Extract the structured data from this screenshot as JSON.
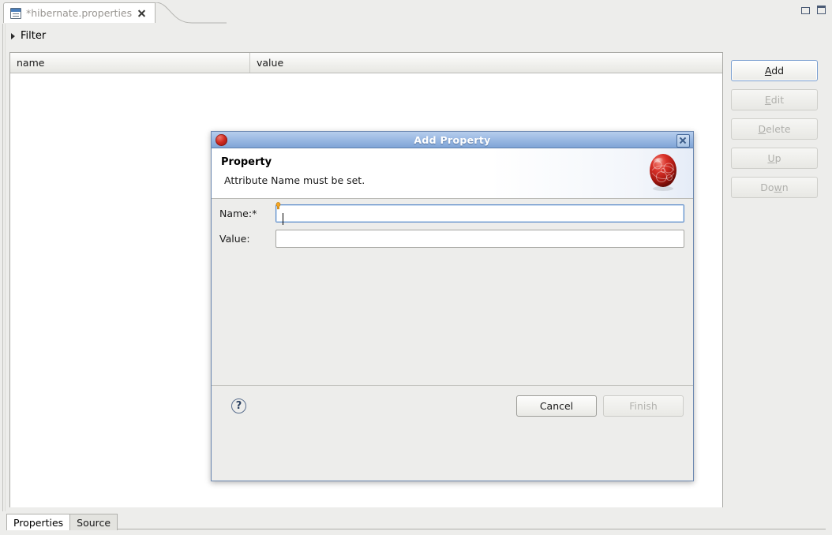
{
  "window": {
    "minimize_icon": "minimize-icon",
    "maximize_icon": "maximize-icon"
  },
  "editor": {
    "tab": {
      "title": "*hibernate.properties",
      "file_icon": "properties-file-icon",
      "close_icon": "close-icon"
    },
    "filter": {
      "label": "Filter",
      "expander_icon": "triangle-right-icon"
    },
    "table": {
      "columns": [
        "name",
        "value"
      ],
      "rows": []
    },
    "side_buttons": [
      {
        "label": "Add",
        "mnemonic": "A",
        "state": "focused"
      },
      {
        "label": "Edit",
        "mnemonic": "E",
        "state": "disabled"
      },
      {
        "label": "Delete",
        "mnemonic": "D",
        "state": "disabled"
      },
      {
        "label": "Up",
        "mnemonic": "U",
        "state": "disabled"
      },
      {
        "label": "Down",
        "mnemonic": "w",
        "state": "disabled"
      }
    ],
    "bottom_tabs": [
      {
        "label": "Properties",
        "active": true
      },
      {
        "label": "Source",
        "active": false
      }
    ]
  },
  "dialog": {
    "title": "Add Property",
    "titlebar_icon": "hibernate-sphere-icon",
    "close_icon": "close-icon",
    "header": {
      "title": "Property",
      "message": "Attribute Name must be set.",
      "logo_icon": "hibernate-logo-icon"
    },
    "fields": [
      {
        "label": "Name:*",
        "value": "",
        "placeholder": "",
        "focused": true,
        "decoration_icon": "content-assist-hint-icon"
      },
      {
        "label": "Value:",
        "value": "",
        "placeholder": "",
        "focused": false,
        "decoration_icon": ""
      }
    ],
    "footer": {
      "help_icon": "help-icon",
      "help_glyph": "?",
      "buttons": [
        {
          "label": "Cancel",
          "state": "enabled"
        },
        {
          "label": "Finish",
          "state": "disabled"
        }
      ]
    }
  },
  "colors": {
    "titlebar_top": "#b6cdec",
    "titlebar_bottom": "#7fa4d6",
    "dialog_bg": "#ededeb",
    "accent_red": "#cf2a20",
    "focus_blue": "#5b8bc9"
  }
}
